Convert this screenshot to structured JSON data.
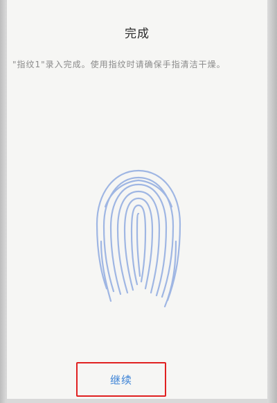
{
  "screen": {
    "title": "完成",
    "message": "\"指纹1\"录入完成。使用指纹时请确保手指清洁干燥。"
  },
  "actions": {
    "continue_label": "继续"
  },
  "icons": {
    "fingerprint": "fingerprint-icon"
  },
  "colors": {
    "accent": "#3b82d6",
    "fingerprint": "#9fb6e3",
    "highlight_box": "#e02020"
  }
}
